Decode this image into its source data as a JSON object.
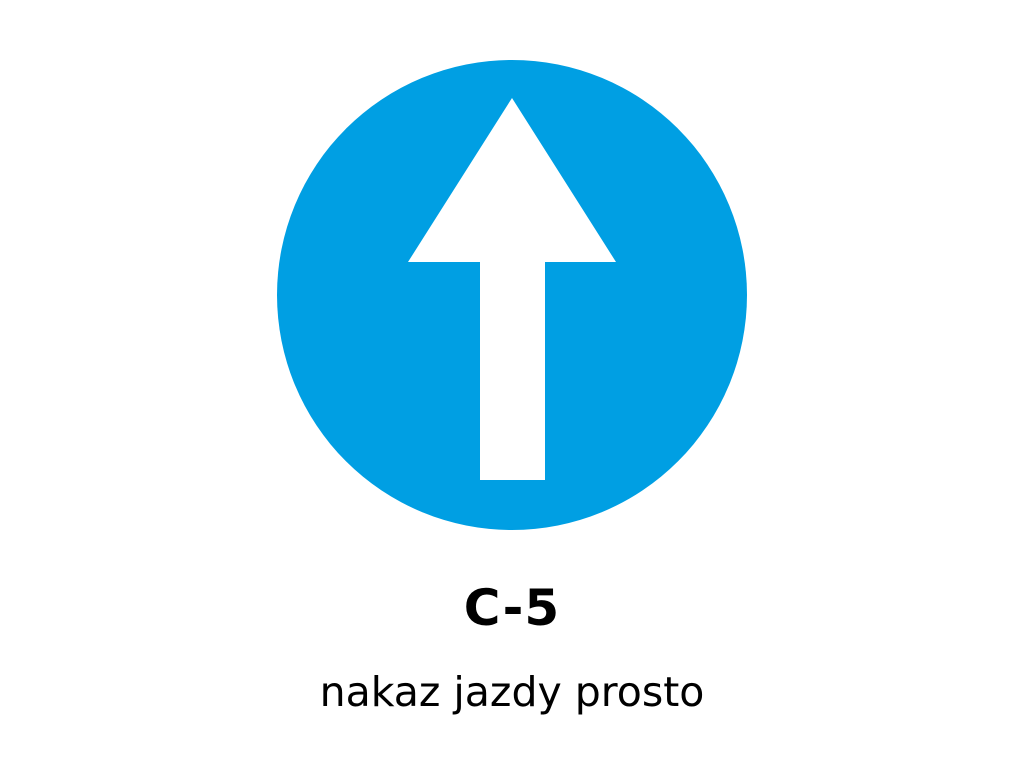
{
  "sign": {
    "code": "C-5",
    "name": "nakaz jazdy prosto",
    "icon": "arrow-up-icon",
    "colors": {
      "background": "#ffffff",
      "disc": "#009fe3",
      "arrow": "#ffffff",
      "text": "#000000"
    }
  }
}
